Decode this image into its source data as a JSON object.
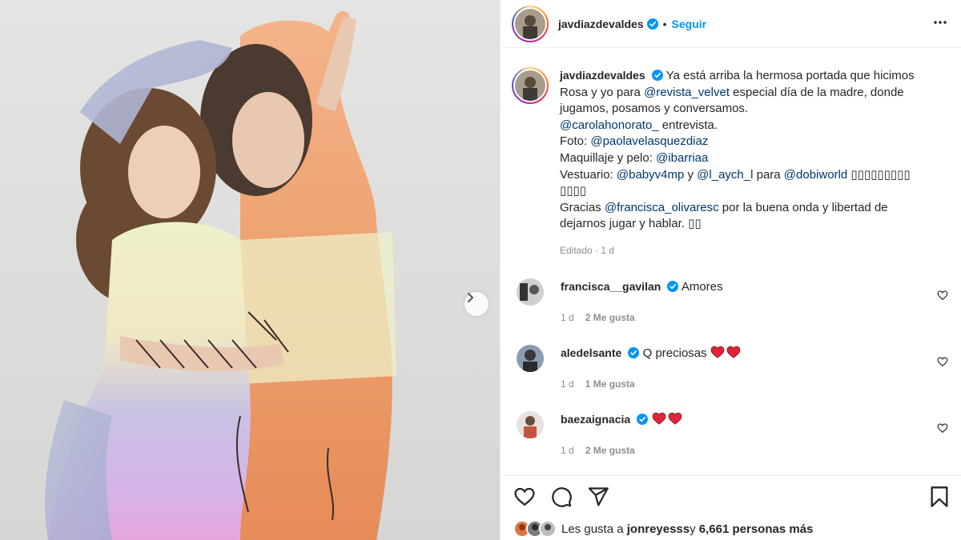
{
  "post": {
    "username": "javdiazdevaldes",
    "follow_label": "Seguir",
    "dot": "•"
  },
  "caption": {
    "username": "javdiazdevaldes",
    "text_1": "Ya está arriba la hermosa portada que hicimos Rosa y yo para ",
    "mention_velvet": "@revista_velvet",
    "text_2": " especial día de la madre, donde jugamos, posamos y conversamos.",
    "mention_carola": "@carolahonorato_",
    "text_3": " entrevista.",
    "foto_label": "Foto: ",
    "mention_paola": "@paolavelasquezdiaz",
    "maquillaje_label": "Maquillaje y pelo: ",
    "mention_ibarriaa": "@ibarriaa",
    "vestuario_label": "Vestuario: ",
    "mention_baby": "@babyv4mp",
    "y": " y ",
    "mention_laych": "@l_aych_l",
    "para": " para ",
    "mention_dobi": "@dobiworld",
    "glyphs_1": " ▯▯▯▯▯▯▯▯▯ ▯▯▯▯",
    "gracias_label": "Gracias ",
    "mention_francisca": "@francisca_olivaresc",
    "text_4": " por la buena onda y libertad de dejarnos jugar y hablar. ",
    "glyphs_2": "▯▯",
    "meta": "Editado · 1 d"
  },
  "comments": [
    {
      "username": "francisca__gavilan",
      "text": "Amores",
      "time": "1 d",
      "likes": "2 Me gusta"
    },
    {
      "username": "aledelsante",
      "text": "Q preciosas ",
      "time": "1 d",
      "likes": "1 Me gusta"
    },
    {
      "username": "baezaignacia",
      "text": "",
      "time": "1 d",
      "likes": "2 Me gusta"
    }
  ],
  "likes": {
    "prefix": "Les gusta a ",
    "user": "jonreyesss",
    "middle": " y ",
    "count": "6,661 personas más"
  },
  "colors": {
    "link": "#00376b",
    "follow": "#0095f6",
    "verified": "#0095f6",
    "heart": "#ed4956",
    "muted": "#8e8e8e"
  }
}
